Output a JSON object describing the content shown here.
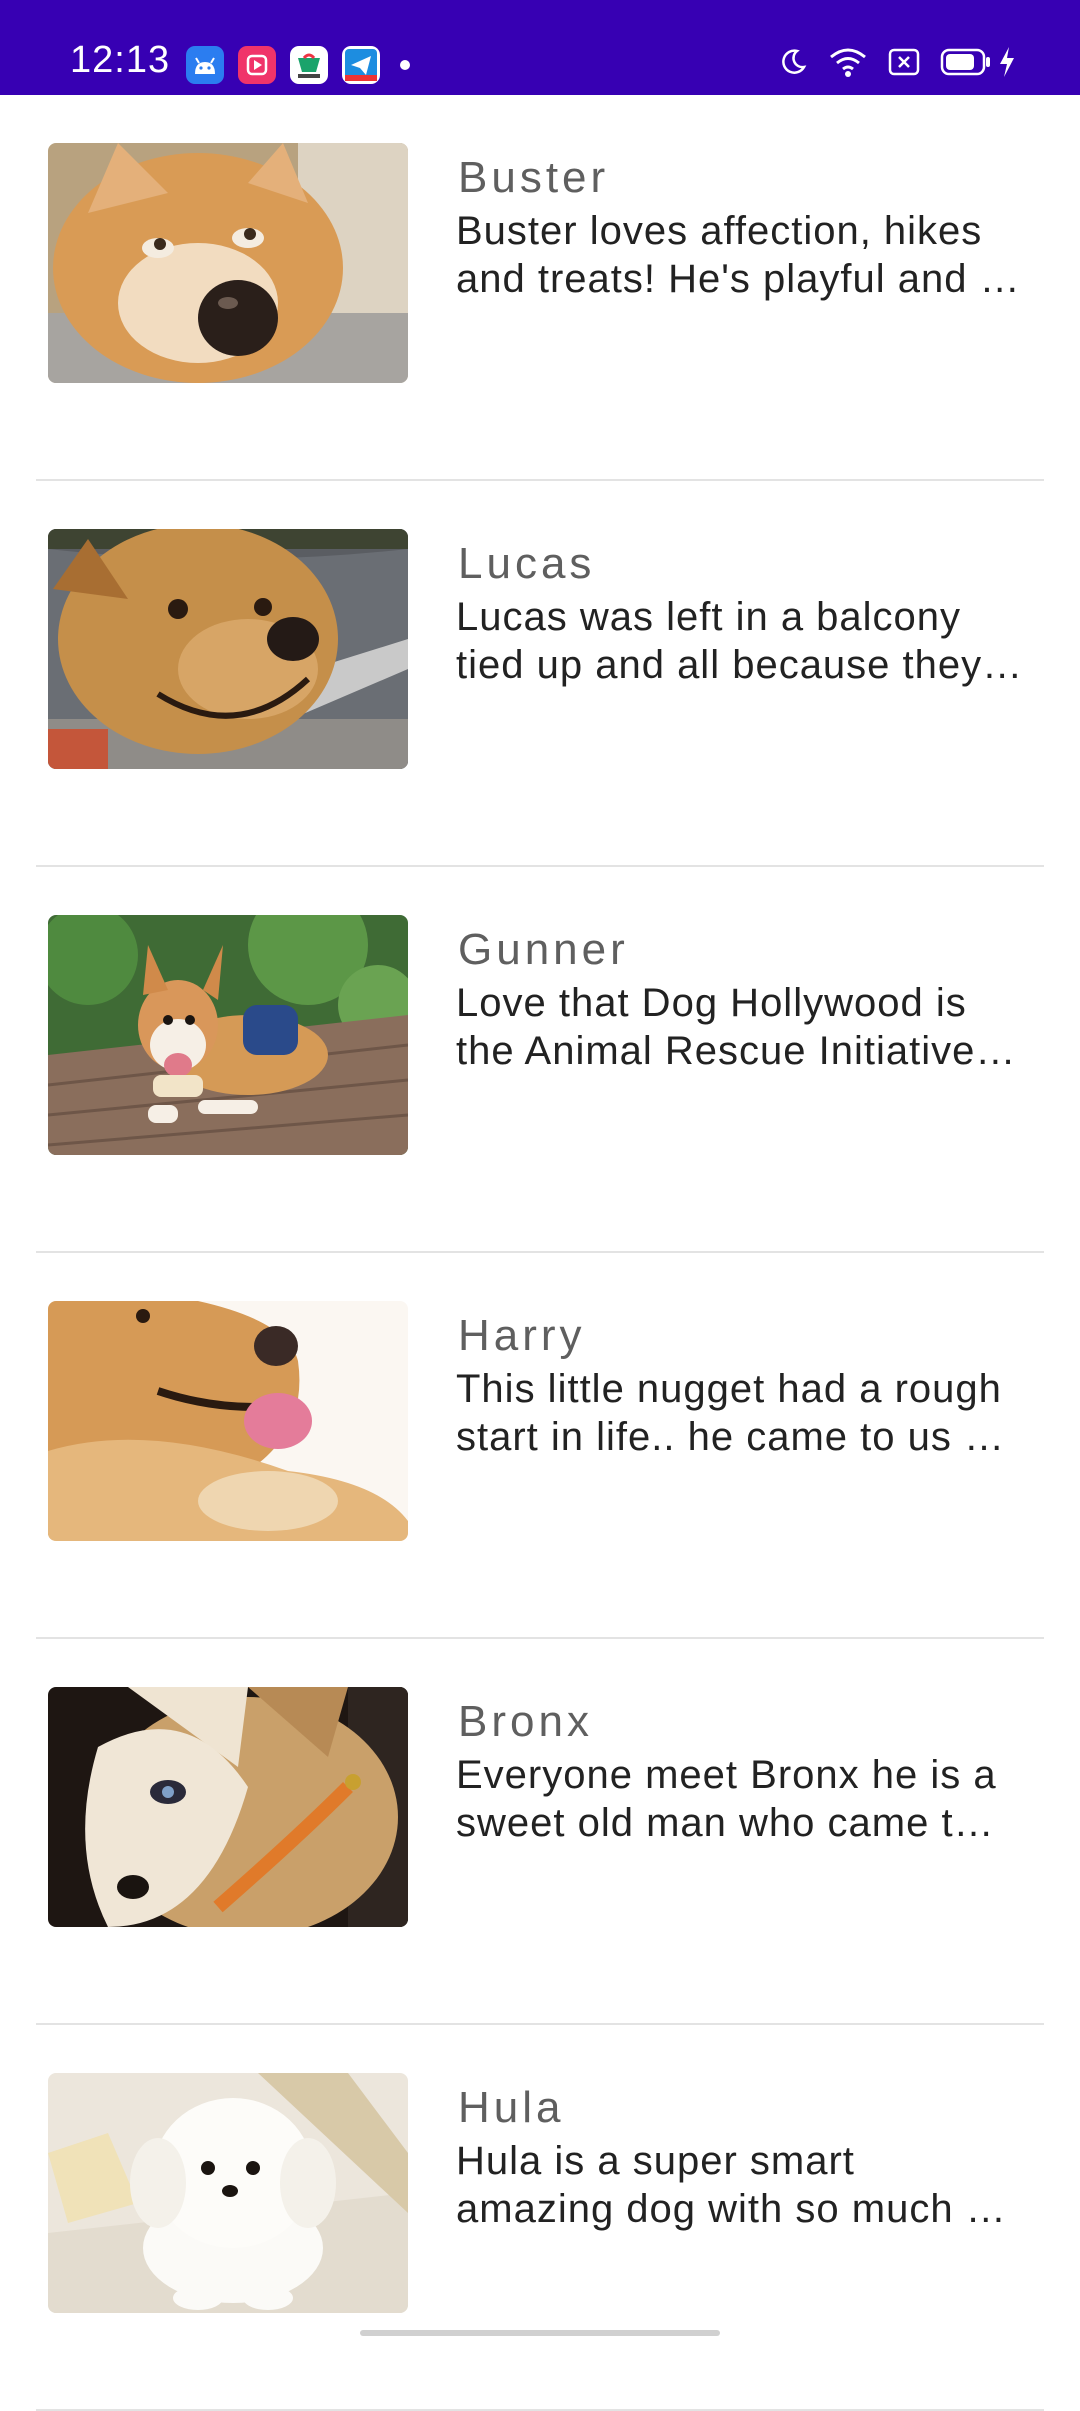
{
  "status_bar": {
    "time": "12:13",
    "background": "#3700b3",
    "notification_icons": [
      "android-icon",
      "play-icon",
      "shop-icon",
      "telegram-icon"
    ],
    "system_icons": [
      "moon-icon",
      "wifi-icon",
      "sim-icon",
      "battery-icon",
      "charging-icon"
    ]
  },
  "dogs": [
    {
      "name": "Buster",
      "desc_line1": "Buster loves affection, hikes",
      "desc_line2": "and treats! He's playful and …",
      "photo": "corgi-closeup-photo"
    },
    {
      "name": "Lucas",
      "desc_line1": "Lucas was left in a balcony",
      "desc_line2": "tied up and all because they…",
      "photo": "smiling-dog-photo"
    },
    {
      "name": "Gunner",
      "desc_line1": "Love that Dog Hollywood is",
      "desc_line2": "the Animal Rescue Initiative…",
      "photo": "corgi-with-backpack-photo"
    },
    {
      "name": "Harry",
      "desc_line1": "This little nugget had a rough",
      "desc_line2": "start in life.. he came to us …",
      "photo": "golden-retriever-photo"
    },
    {
      "name": "Bronx",
      "desc_line1": "Everyone meet Bronx he is a",
      "desc_line2": "sweet old man who came t…",
      "photo": "puppy-with-collar-photo"
    },
    {
      "name": "Hula",
      "desc_line1": "Hula is a super smart",
      "desc_line2": "amazing dog with so much …",
      "photo": "white-puppy-photo"
    }
  ]
}
